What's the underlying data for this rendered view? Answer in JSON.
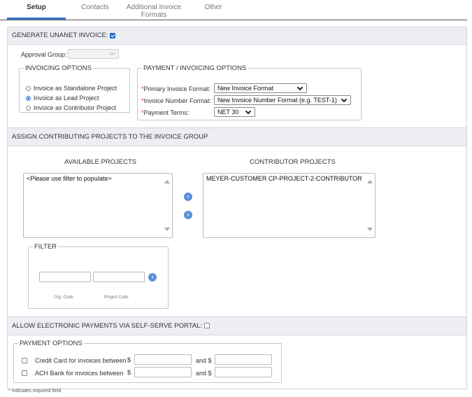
{
  "tabs": [
    {
      "label": "Setup",
      "active": true
    },
    {
      "label": "Contacts",
      "active": false
    },
    {
      "label": "Additional Invoice Formats",
      "active": false
    },
    {
      "label": "Other",
      "active": false
    }
  ],
  "generate": {
    "label": "GENERATE UNANET INVOICE:",
    "checked": true
  },
  "approval_group": {
    "label": "Approval Group:",
    "value": ""
  },
  "invoicing_options": {
    "legend": "INVOICING OPTIONS",
    "options": [
      {
        "label": "Invoice as Standalone Project",
        "selected": false
      },
      {
        "label": "Invoice as Lead Project",
        "selected": true
      },
      {
        "label": "Invoice as Contributor Project",
        "selected": false
      }
    ]
  },
  "payment_invoicing": {
    "legend": "PAYMENT / INVOICING OPTIONS",
    "primary_format": {
      "label": "Primary Invoice Format:",
      "value": "New Invoice Format"
    },
    "number_format": {
      "label": "Invoice Number Format:",
      "value": "New Invoice Number Format (e.g. TEST-1)"
    },
    "payment_terms": {
      "label": "Payment Terms:",
      "value": "NET 30"
    }
  },
  "assign": {
    "label": "ASSIGN CONTRIBUTING PROJECTS TO THE INVOICE GROUP",
    "available_title": "AVAILABLE PROJECTS",
    "available_items": [
      "<Please use filter to populate>"
    ],
    "contributor_title": "CONTRIBUTOR PROJECTS",
    "contributor_items": [
      "MEYER-CUSTOMER CP-PROJECT-2-CONTRIBUTOR"
    ]
  },
  "filter": {
    "legend": "FILTER",
    "org_code_caption": "Org. Code",
    "project_code_caption": "Project Code",
    "org_code_value": "",
    "project_code_value": ""
  },
  "electronic": {
    "label": "ALLOW ELECTRONIC PAYMENTS VIA SELF-SERVE PORTAL:",
    "checked": false
  },
  "payment_options": {
    "legend": "PAYMENT OPTIONS",
    "rows": [
      {
        "label": "Credit Card for invoices between",
        "currency": "$",
        "and_label": "and $",
        "checked": false
      },
      {
        "label": "ACH Bank for invoices between",
        "currency": "$",
        "and_label": "and $",
        "checked": false
      }
    ]
  },
  "footnote": {
    "marker": "*",
    "text": "Indicates required field"
  },
  "colors": {
    "accent": "#3a75c4",
    "required": "#cc3333",
    "section_bar": "#eceef3"
  }
}
